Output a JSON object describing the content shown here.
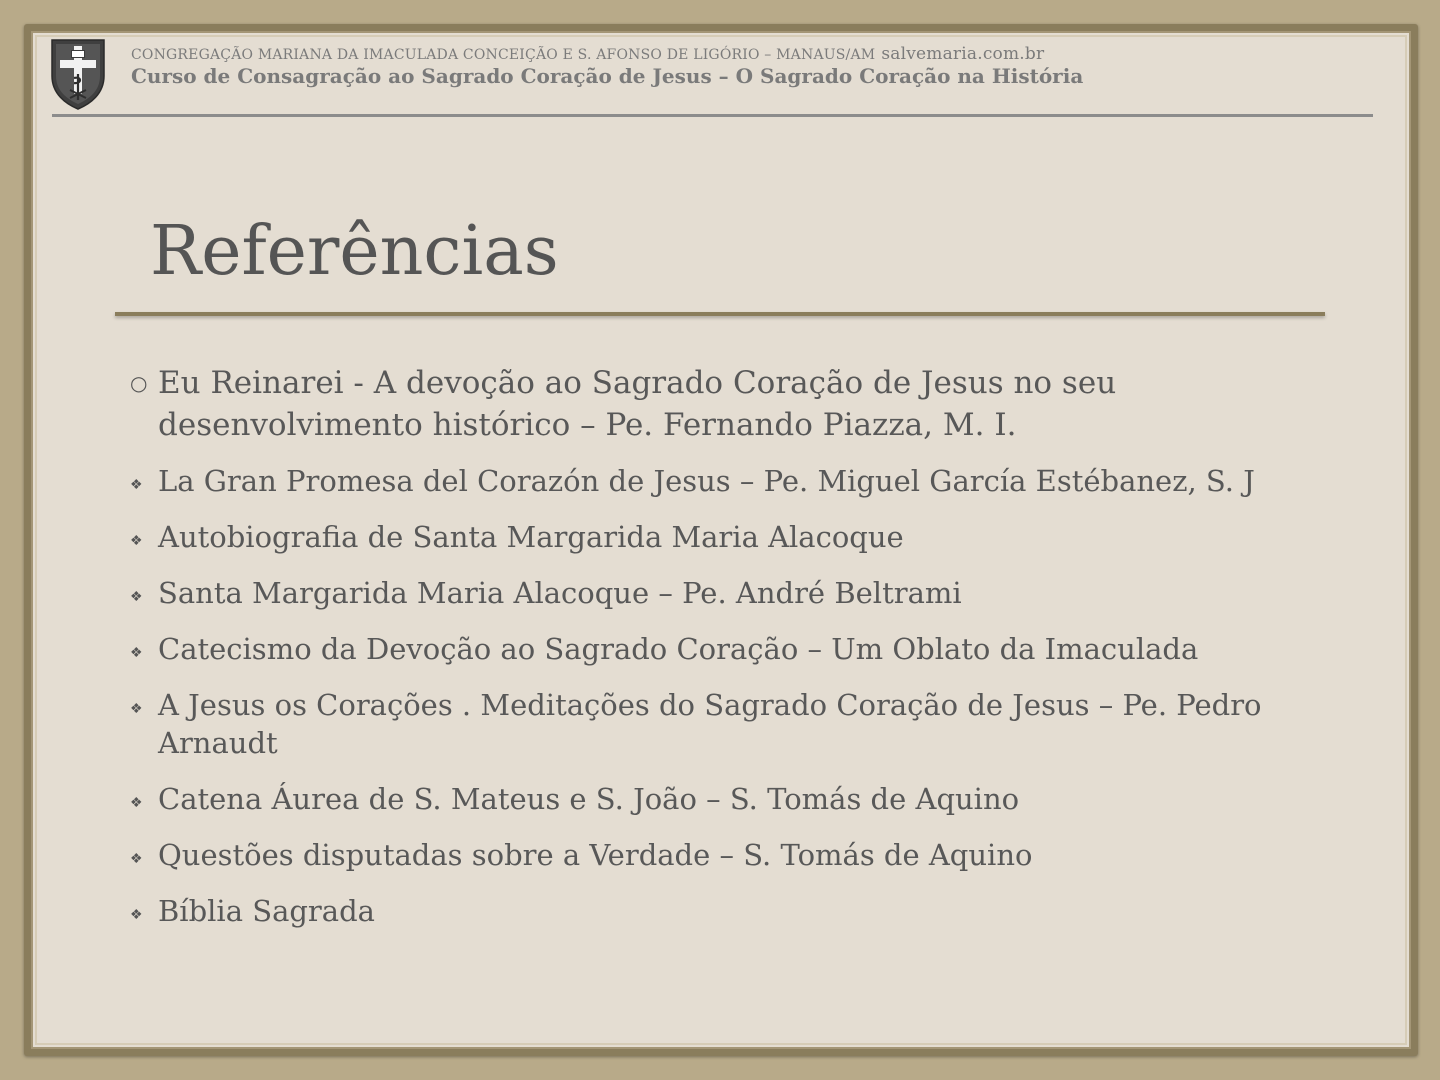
{
  "header": {
    "organization": "CONGREGAÇÃO MARIANA DA IMACULADA CONCEIÇÃO E S. AFONSO DE LIGÓRIO – MANAUS/AM",
    "website": "salvemaria.com.br",
    "course": "Curso de Consagração ao Sagrado Coração de Jesus – O Sagrado Coração na História"
  },
  "slide": {
    "title": "Referências"
  },
  "references": [
    {
      "bullet": "circle",
      "text": "Eu Reinarei - A devoção ao Sagrado Coração de Jesus no seu desenvolvimento histórico – Pe. Fernando Piazza, M. I."
    },
    {
      "bullet": "diamond",
      "text": "La Gran Promesa del Corazón de Jesus – Pe. Miguel García Estébanez, S. J"
    },
    {
      "bullet": "diamond",
      "text": "Autobiografia de Santa Margarida Maria Alacoque"
    },
    {
      "bullet": "diamond",
      "text": "Santa Margarida Maria Alacoque – Pe. André Beltrami"
    },
    {
      "bullet": "diamond",
      "text": "Catecismo da Devoção ao Sagrado Coração – Um Oblato da Imaculada"
    },
    {
      "bullet": "diamond",
      "text": "A Jesus os Corações . Meditações do Sagrado Coração de Jesus – Pe. Pedro Arnaudt"
    },
    {
      "bullet": "diamond",
      "text": "Catena Áurea de S. Mateus e S. João – S. Tomás de Aquino"
    },
    {
      "bullet": "diamond",
      "text": "Questões disputadas sobre a Verdade – S. Tomás de Aquino"
    },
    {
      "bullet": "diamond",
      "text": "Bíblia Sagrada"
    }
  ],
  "icons": {
    "logo": "shield-cross-crest-icon"
  },
  "colors": {
    "background": "#b8aa89",
    "slide": "#e4ddd2",
    "accent": "#8a7d5c",
    "text": "#585858"
  }
}
